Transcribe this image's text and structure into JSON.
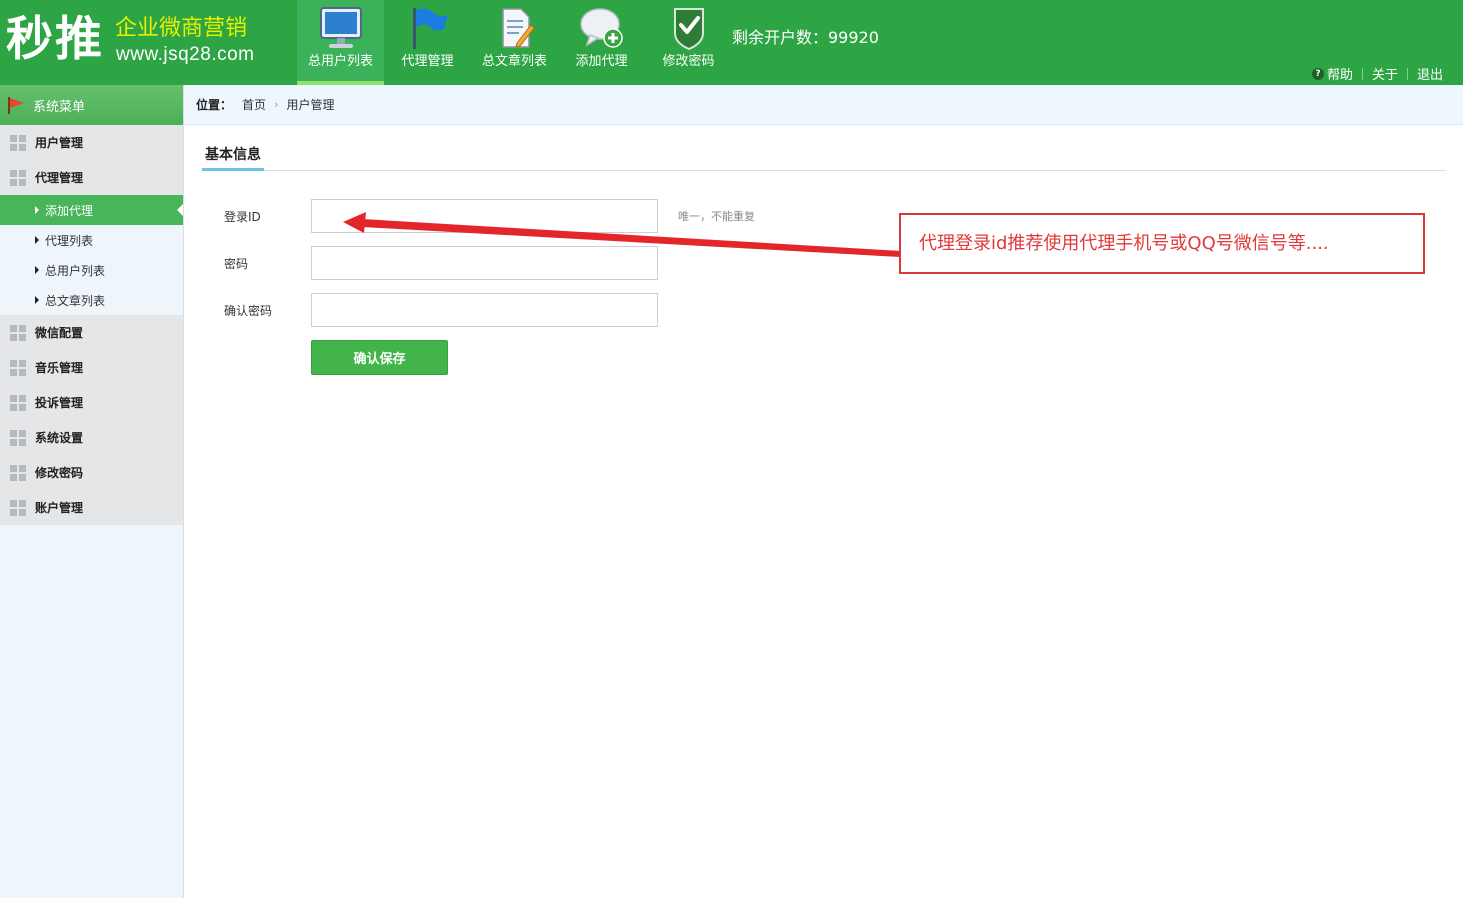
{
  "header": {
    "logo_main": "秒推",
    "logo_slogan": "企业微商营销",
    "logo_url": "www.jsq28.com",
    "nav": [
      {
        "label": "总用户列表",
        "icon": "monitor-icon",
        "active": true
      },
      {
        "label": "代理管理",
        "icon": "flag-icon"
      },
      {
        "label": "总文章列表",
        "icon": "document-edit-icon"
      },
      {
        "label": "添加代理",
        "icon": "chat-add-icon"
      },
      {
        "label": "修改密码",
        "icon": "shield-check-icon"
      }
    ],
    "remaining": "剩余开户数：99920",
    "links": {
      "help": "帮助",
      "about": "关于",
      "logout": "退出"
    }
  },
  "sidebar": {
    "title": "系统菜单",
    "items": [
      {
        "label": "用户管理"
      },
      {
        "label": "代理管理"
      },
      {
        "label": "微信配置"
      },
      {
        "label": "音乐管理"
      },
      {
        "label": "投诉管理"
      },
      {
        "label": "系统设置"
      },
      {
        "label": "修改密码"
      },
      {
        "label": "账户管理"
      }
    ],
    "subitems": [
      {
        "label": "添加代理",
        "active": true
      },
      {
        "label": "代理列表"
      },
      {
        "label": "总用户列表"
      },
      {
        "label": "总文章列表"
      }
    ]
  },
  "breadcrumb": {
    "label": "位置：",
    "home": "首页",
    "current": "用户管理"
  },
  "tab": "基本信息",
  "form": {
    "login_id": {
      "label": "登录ID",
      "value": "",
      "hint": "唯一，不能重复"
    },
    "password": {
      "label": "密码",
      "value": ""
    },
    "confirm_password": {
      "label": "确认密码",
      "value": ""
    },
    "save_label": "确认保存"
  },
  "annotation": {
    "text": "代理登录id推荐使用代理手机号或QQ号微信号等....",
    "color": "#e0393b"
  },
  "colors": {
    "brand_green": "#2ea544",
    "accent_green": "#43b449"
  }
}
